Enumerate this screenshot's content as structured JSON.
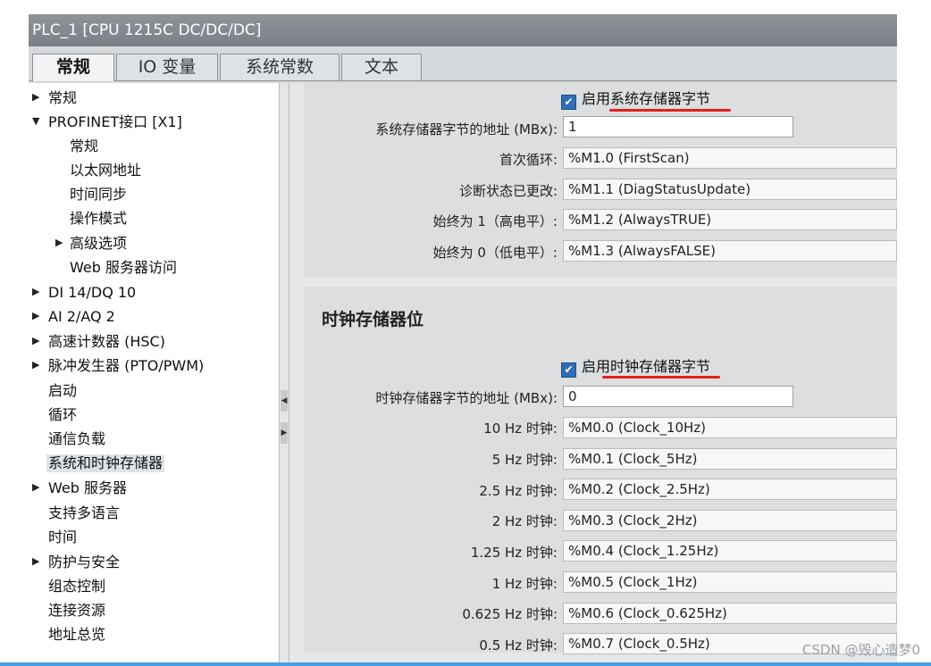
{
  "window": {
    "title": "PLC_1 [CPU 1215C DC/DC/DC]"
  },
  "tabs": [
    {
      "label": "常规"
    },
    {
      "label": "IO 变量"
    },
    {
      "label": "系统常数"
    },
    {
      "label": "文本"
    }
  ],
  "tree": [
    {
      "label": "常规",
      "arrow": "▶"
    },
    {
      "label": "PROFINET接口 [X1]",
      "arrow": "▼"
    },
    {
      "label": "常规",
      "arrow": ""
    },
    {
      "label": "以太网地址",
      "arrow": ""
    },
    {
      "label": "时间同步",
      "arrow": ""
    },
    {
      "label": "操作模式",
      "arrow": ""
    },
    {
      "label": "高级选项",
      "arrow": "▶"
    },
    {
      "label": "Web 服务器访问",
      "arrow": ""
    },
    {
      "label": "DI 14/DQ 10",
      "arrow": "▶"
    },
    {
      "label": "AI 2/AQ 2",
      "arrow": "▶"
    },
    {
      "label": "高速计数器 (HSC)",
      "arrow": "▶"
    },
    {
      "label": "脉冲发生器 (PTO/PWM)",
      "arrow": "▶"
    },
    {
      "label": "启动",
      "arrow": ""
    },
    {
      "label": "循环",
      "arrow": ""
    },
    {
      "label": "通信负载",
      "arrow": ""
    },
    {
      "label": "系统和时钟存储器",
      "arrow": ""
    },
    {
      "label": "Web 服务器",
      "arrow": "▶"
    },
    {
      "label": "支持多语言",
      "arrow": ""
    },
    {
      "label": "时间",
      "arrow": ""
    },
    {
      "label": "防护与安全",
      "arrow": "▶"
    },
    {
      "label": "组态控制",
      "arrow": ""
    },
    {
      "label": "连接资源",
      "arrow": ""
    },
    {
      "label": "地址总览",
      "arrow": ""
    }
  ],
  "system_memory": {
    "checkbox_label": "启用系统存储器字节",
    "checked": true,
    "address_label": "系统存储器字节的地址 (MBx):",
    "address_value": "1",
    "rows": [
      {
        "label": "首次循环:",
        "value": "%M1.0 (FirstScan)"
      },
      {
        "label": "诊断状态已更改:",
        "value": "%M1.1 (DiagStatusUpdate)"
      },
      {
        "label": "始终为 1（高电平）:",
        "value": "%M1.2 (AlwaysTRUE)"
      },
      {
        "label": "始终为 0（低电平）:",
        "value": "%M1.3 (AlwaysFALSE)"
      }
    ]
  },
  "clock_memory": {
    "title": "时钟存储器位",
    "checkbox_label": "启用时钟存储器字节",
    "checked": true,
    "address_label": "时钟存储器字节的地址 (MBx):",
    "address_value": "0",
    "rows": [
      {
        "label": "10 Hz 时钟:",
        "value": "%M0.0 (Clock_10Hz)"
      },
      {
        "label": "5 Hz 时钟:",
        "value": "%M0.1 (Clock_5Hz)"
      },
      {
        "label": "2.5 Hz 时钟:",
        "value": "%M0.2 (Clock_2.5Hz)"
      },
      {
        "label": "2 Hz 时钟:",
        "value": "%M0.3 (Clock_2Hz)"
      },
      {
        "label": "1.25 Hz 时钟:",
        "value": "%M0.4 (Clock_1.25Hz)"
      },
      {
        "label": "1 Hz 时钟:",
        "value": "%M0.5 (Clock_1Hz)"
      },
      {
        "label": "0.625 Hz 时钟:",
        "value": "%M0.6 (Clock_0.625Hz)"
      },
      {
        "label": "0.5 Hz 时钟:",
        "value": "%M0.7 (Clock_0.5Hz)"
      }
    ]
  },
  "watermark": "CSDN @毁心造梦0",
  "colors": {
    "annotation_underline": "#e3201a",
    "checkbox": "#2f6fb5"
  }
}
